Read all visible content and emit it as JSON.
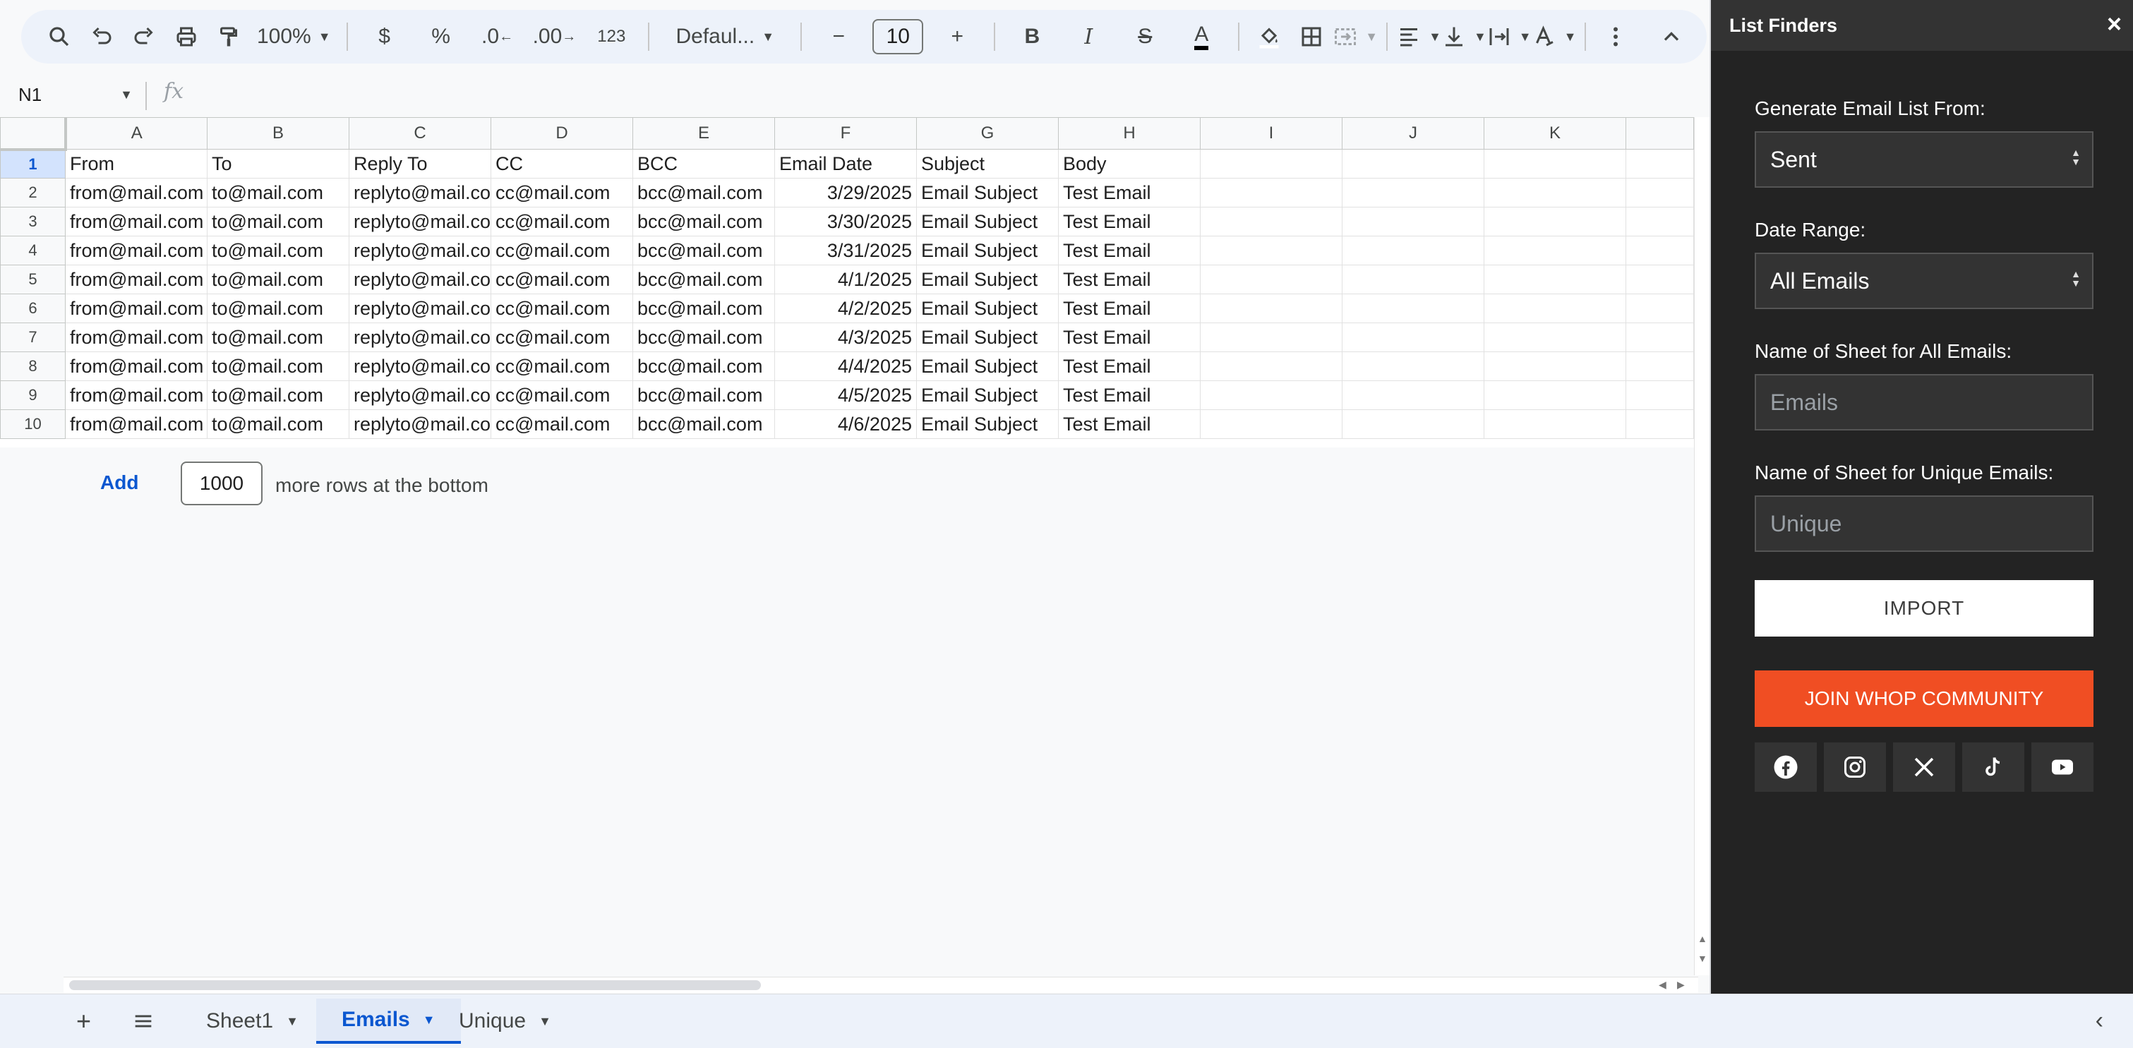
{
  "toolbar": {
    "zoom": "100%",
    "currency": "$",
    "percent": "%",
    "dec_decrease": ".0",
    "dec_increase": ".00",
    "number_format": "123",
    "font": "Defaul...",
    "font_size": "10",
    "text_color": "#000000"
  },
  "formula_bar": {
    "cell_ref": "N1",
    "fx": "fx",
    "value": ""
  },
  "grid": {
    "columns": [
      "A",
      "B",
      "C",
      "D",
      "E",
      "F",
      "G",
      "H",
      "I",
      "J",
      "K"
    ],
    "active_row": 1,
    "rows": [
      {
        "n": "1",
        "cells": [
          "From",
          "To",
          "Reply To",
          "CC",
          "BCC",
          "Email Date",
          "Subject",
          "Body",
          "",
          "",
          ""
        ]
      },
      {
        "n": "2",
        "cells": [
          "from@mail.com",
          "to@mail.com",
          "replyto@mail.com",
          "cc@mail.com",
          "bcc@mail.com",
          "3/29/2025",
          "Email Subject",
          "Test Email",
          "",
          "",
          ""
        ]
      },
      {
        "n": "3",
        "cells": [
          "from@mail.com",
          "to@mail.com",
          "replyto@mail.com",
          "cc@mail.com",
          "bcc@mail.com",
          "3/30/2025",
          "Email Subject",
          "Test Email",
          "",
          "",
          ""
        ]
      },
      {
        "n": "4",
        "cells": [
          "from@mail.com",
          "to@mail.com",
          "replyto@mail.com",
          "cc@mail.com",
          "bcc@mail.com",
          "3/31/2025",
          "Email Subject",
          "Test Email",
          "",
          "",
          ""
        ]
      },
      {
        "n": "5",
        "cells": [
          "from@mail.com",
          "to@mail.com",
          "replyto@mail.com",
          "cc@mail.com",
          "bcc@mail.com",
          "4/1/2025",
          "Email Subject",
          "Test Email",
          "",
          "",
          ""
        ]
      },
      {
        "n": "6",
        "cells": [
          "from@mail.com",
          "to@mail.com",
          "replyto@mail.com",
          "cc@mail.com",
          "bcc@mail.com",
          "4/2/2025",
          "Email Subject",
          "Test Email",
          "",
          "",
          ""
        ]
      },
      {
        "n": "7",
        "cells": [
          "from@mail.com",
          "to@mail.com",
          "replyto@mail.com",
          "cc@mail.com",
          "bcc@mail.com",
          "4/3/2025",
          "Email Subject",
          "Test Email",
          "",
          "",
          ""
        ]
      },
      {
        "n": "8",
        "cells": [
          "from@mail.com",
          "to@mail.com",
          "replyto@mail.com",
          "cc@mail.com",
          "bcc@mail.com",
          "4/4/2025",
          "Email Subject",
          "Test Email",
          "",
          "",
          ""
        ]
      },
      {
        "n": "9",
        "cells": [
          "from@mail.com",
          "to@mail.com",
          "replyto@mail.com",
          "cc@mail.com",
          "bcc@mail.com",
          "4/5/2025",
          "Email Subject",
          "Test Email",
          "",
          "",
          ""
        ]
      },
      {
        "n": "10",
        "cells": [
          "from@mail.com",
          "to@mail.com",
          "replyto@mail.com",
          "cc@mail.com",
          "bcc@mail.com",
          "4/6/2025",
          "Email Subject",
          "Test Email",
          "",
          "",
          ""
        ]
      }
    ]
  },
  "add_rows": {
    "link": "Add",
    "count": "1000",
    "suffix": "more rows at the bottom"
  },
  "sheet_tabs": [
    {
      "label": "Sheet1",
      "active": false
    },
    {
      "label": "Emails",
      "active": true
    },
    {
      "label": "Unique",
      "active": false
    }
  ],
  "panel": {
    "title": "List Finders",
    "source_label": "Generate Email List From:",
    "source_value": "Sent",
    "range_label": "Date Range:",
    "range_value": "All Emails",
    "all_label": "Name of Sheet for All Emails:",
    "all_placeholder": "Emails",
    "unique_label": "Name of Sheet for Unique Emails:",
    "unique_placeholder": "Unique",
    "import_label": "IMPORT",
    "join_label": "JOIN WHOP COMMUNITY",
    "socials": [
      "facebook-icon",
      "instagram-icon",
      "x-icon",
      "tiktok-icon",
      "youtube-icon"
    ],
    "accent": "#f04e23"
  }
}
